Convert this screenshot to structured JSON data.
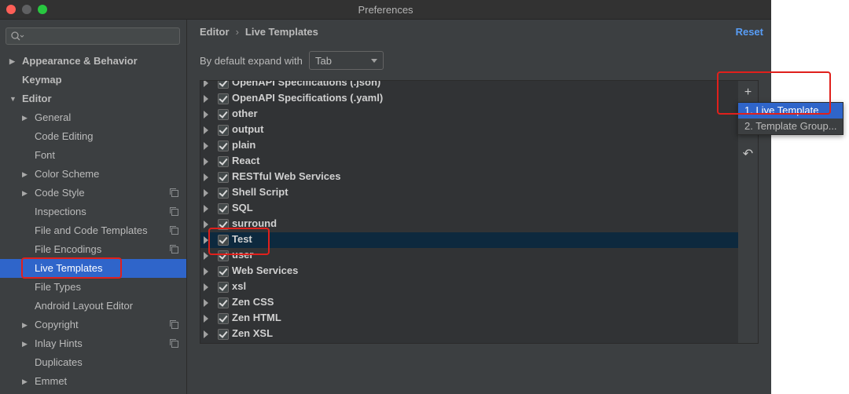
{
  "window": {
    "title": "Preferences"
  },
  "sidebar": {
    "search_placeholder": "",
    "items": [
      {
        "label": "Appearance & Behavior",
        "level": 0,
        "expandable": true,
        "expanded": false,
        "bold": true
      },
      {
        "label": "Keymap",
        "level": 0,
        "expandable": false,
        "bold": true
      },
      {
        "label": "Editor",
        "level": 0,
        "expandable": true,
        "expanded": true,
        "bold": true
      },
      {
        "label": "General",
        "level": 1,
        "expandable": true
      },
      {
        "label": "Code Editing",
        "level": 1
      },
      {
        "label": "Font",
        "level": 1
      },
      {
        "label": "Color Scheme",
        "level": 1,
        "expandable": true
      },
      {
        "label": "Code Style",
        "level": 1,
        "expandable": true,
        "project_icon": true
      },
      {
        "label": "Inspections",
        "level": 1,
        "project_icon": true
      },
      {
        "label": "File and Code Templates",
        "level": 1,
        "project_icon": true
      },
      {
        "label": "File Encodings",
        "level": 1,
        "project_icon": true
      },
      {
        "label": "Live Templates",
        "level": 1,
        "selected": true
      },
      {
        "label": "File Types",
        "level": 1
      },
      {
        "label": "Android Layout Editor",
        "level": 1
      },
      {
        "label": "Copyright",
        "level": 1,
        "expandable": true,
        "project_icon": true
      },
      {
        "label": "Inlay Hints",
        "level": 1,
        "expandable": true,
        "project_icon": true
      },
      {
        "label": "Duplicates",
        "level": 1
      },
      {
        "label": "Emmet",
        "level": 1,
        "expandable": true
      }
    ]
  },
  "main": {
    "breadcrumb": {
      "parent": "Editor",
      "separator": "›",
      "current": "Live Templates"
    },
    "reset_label": "Reset",
    "expand_label": "By default expand with",
    "expand_value": "Tab",
    "template_groups": [
      {
        "name": "OpenAPI Specifications (.json)",
        "checked": true
      },
      {
        "name": "OpenAPI Specifications (.yaml)",
        "checked": true
      },
      {
        "name": "other",
        "checked": true
      },
      {
        "name": "output",
        "checked": true
      },
      {
        "name": "plain",
        "checked": true
      },
      {
        "name": "React",
        "checked": true
      },
      {
        "name": "RESTful Web Services",
        "checked": true
      },
      {
        "name": "Shell Script",
        "checked": true
      },
      {
        "name": "SQL",
        "checked": true
      },
      {
        "name": "surround",
        "checked": true
      },
      {
        "name": "Test",
        "checked": true,
        "selected": true
      },
      {
        "name": "user",
        "checked": true
      },
      {
        "name": "Web Services",
        "checked": true
      },
      {
        "name": "xsl",
        "checked": true
      },
      {
        "name": "Zen CSS",
        "checked": true
      },
      {
        "name": "Zen HTML",
        "checked": true
      },
      {
        "name": "Zen XSL",
        "checked": true
      }
    ],
    "toolbar": {
      "add": "+",
      "restore": "↶"
    },
    "add_menu": [
      {
        "label": "1. Live Template",
        "selected": true
      },
      {
        "label": "2. Template Group..."
      }
    ]
  },
  "colors": {
    "selection": "#2f65ca",
    "list_selection": "#0d293e",
    "link": "#589df6",
    "highlight_box": "#e0201c"
  }
}
